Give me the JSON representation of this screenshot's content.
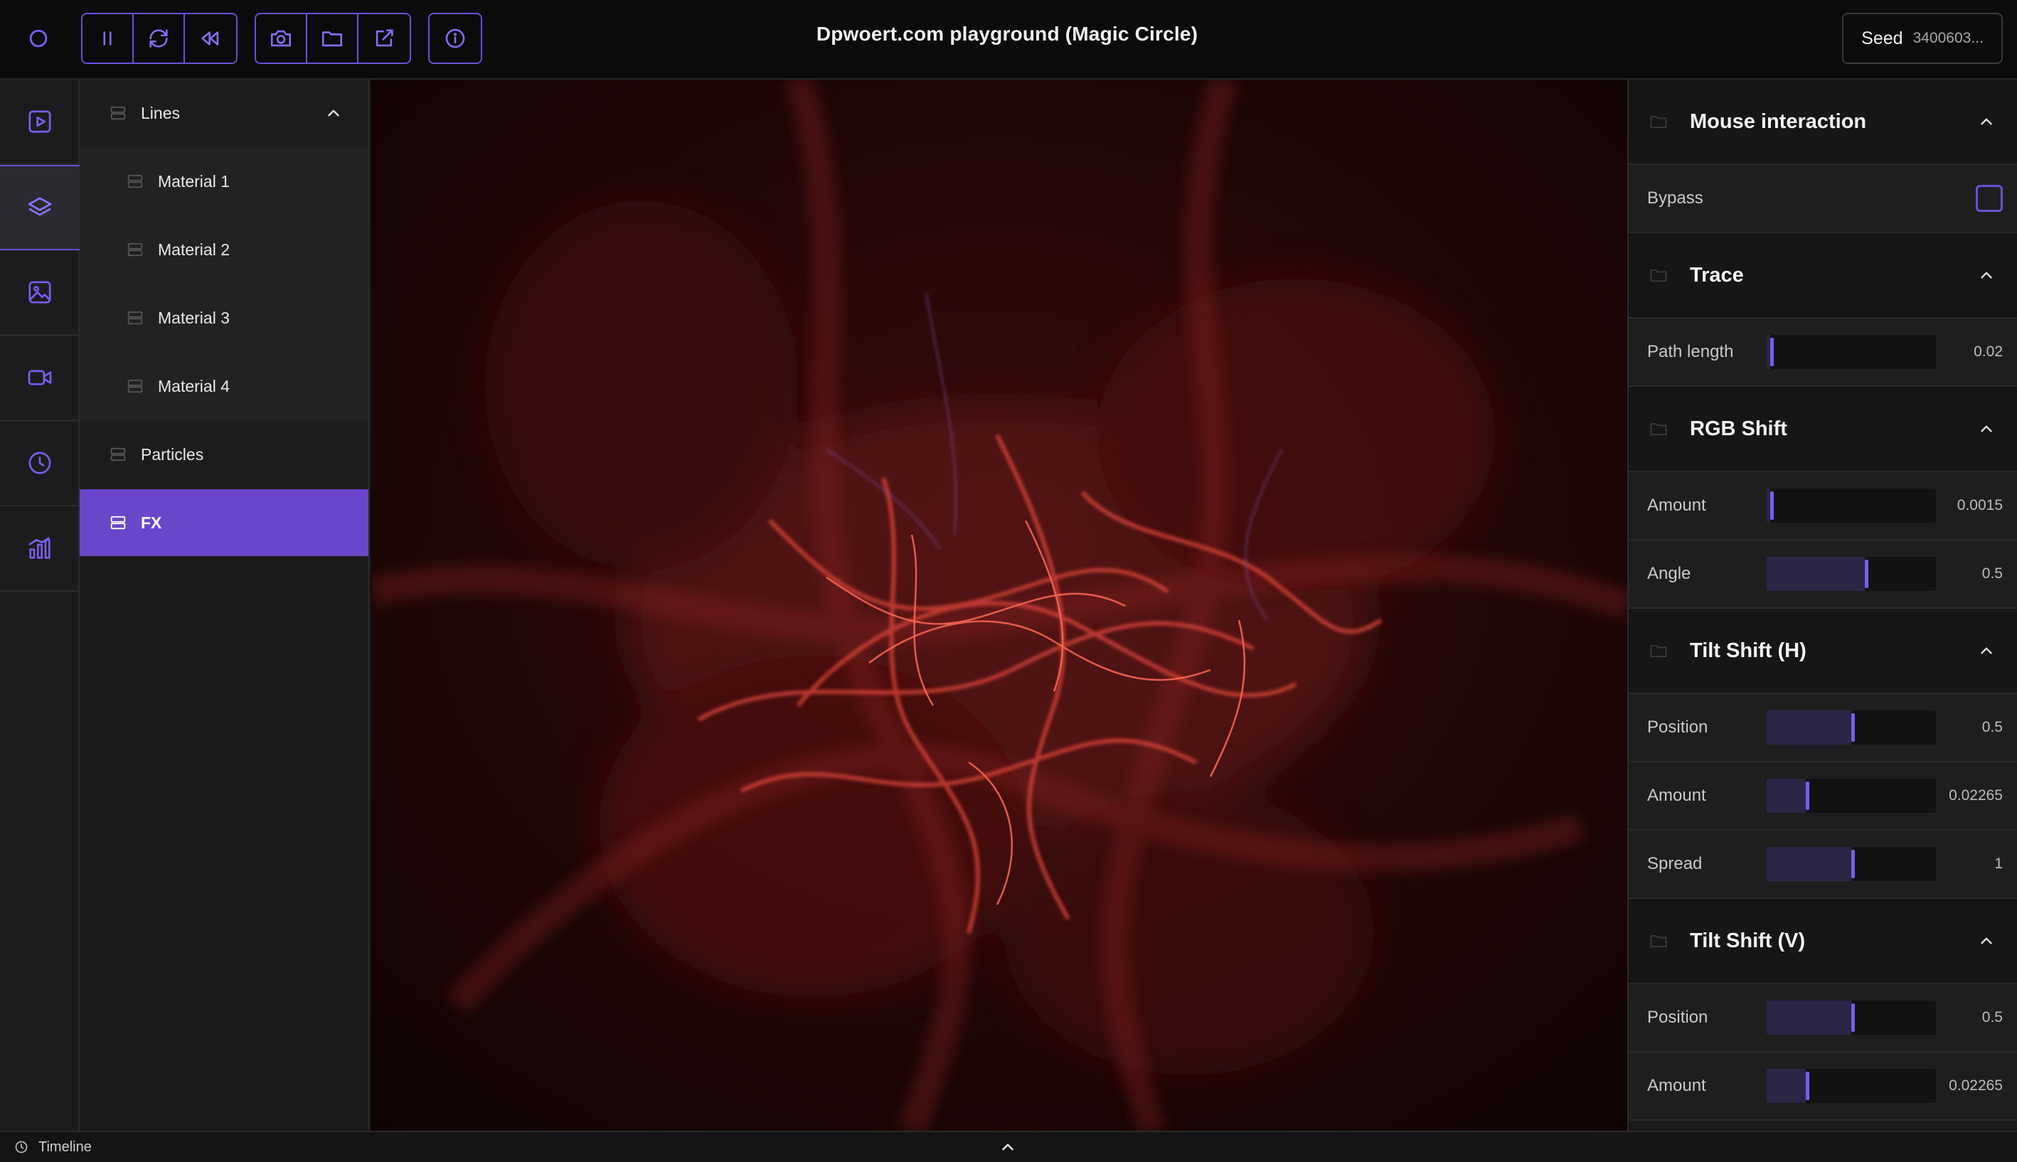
{
  "app": {
    "title": "Dpwoert.com playground (Magic Circle)",
    "accent_color": "#6b4fd8",
    "logo_icon": "circle-logo-icon"
  },
  "toolbar": {
    "playback": [
      {
        "icon": "pause-icon"
      },
      {
        "icon": "refresh-icon"
      },
      {
        "icon": "rewind-icon"
      }
    ],
    "files": [
      {
        "icon": "camera-icon"
      },
      {
        "icon": "folder-icon"
      },
      {
        "icon": "export-icon"
      }
    ],
    "info": {
      "icon": "info-icon"
    },
    "seed": {
      "label": "Seed",
      "value": "3400603..."
    }
  },
  "rail": {
    "items": [
      {
        "icon": "play-square-icon",
        "active": false
      },
      {
        "icon": "layers-icon",
        "active": true
      },
      {
        "icon": "image-icon",
        "active": false
      },
      {
        "icon": "video-icon",
        "active": false
      },
      {
        "icon": "clock-icon",
        "active": false
      },
      {
        "icon": "bar-chart-icon",
        "active": false
      }
    ]
  },
  "layers": {
    "items": [
      {
        "label": "Lines",
        "level": 0,
        "expanded": true
      },
      {
        "label": "Material 1",
        "level": 1
      },
      {
        "label": "Material 2",
        "level": 1
      },
      {
        "label": "Material 3",
        "level": 1
      },
      {
        "label": "Material 4",
        "level": 1
      },
      {
        "label": "Particles",
        "level": 0
      },
      {
        "label": "FX",
        "level": 0,
        "active": true
      }
    ]
  },
  "props": {
    "mouse": {
      "title": "Mouse interaction",
      "bypass_label": "Bypass",
      "bypass_checked": false
    },
    "trace": {
      "title": "Trace",
      "path_length_label": "Path length",
      "path_length_value": "0.02",
      "path_length_level": 0.02
    },
    "rgb": {
      "title": "RGB Shift",
      "amount_label": "Amount",
      "amount_value": "0.0015",
      "amount_level": 0.02,
      "angle_label": "Angle",
      "angle_value": "0.5",
      "angle_level": 0.58
    },
    "tilt_h": {
      "title": "Tilt Shift (H)",
      "position_label": "Position",
      "position_value": "0.5",
      "position_level": 0.5,
      "amount_label": "Amount",
      "amount_value": "0.02265",
      "amount_level": 0.23,
      "spread_label": "Spread",
      "spread_value": "1",
      "spread_level": 0.5
    },
    "tilt_v": {
      "title": "Tilt Shift (V)",
      "position_label": "Position",
      "position_value": "0.5",
      "position_level": 0.5,
      "amount_label": "Amount",
      "amount_value": "0.02265",
      "amount_level": 0.23
    }
  },
  "timeline": {
    "label": "Timeline",
    "icon": "clock-icon"
  }
}
